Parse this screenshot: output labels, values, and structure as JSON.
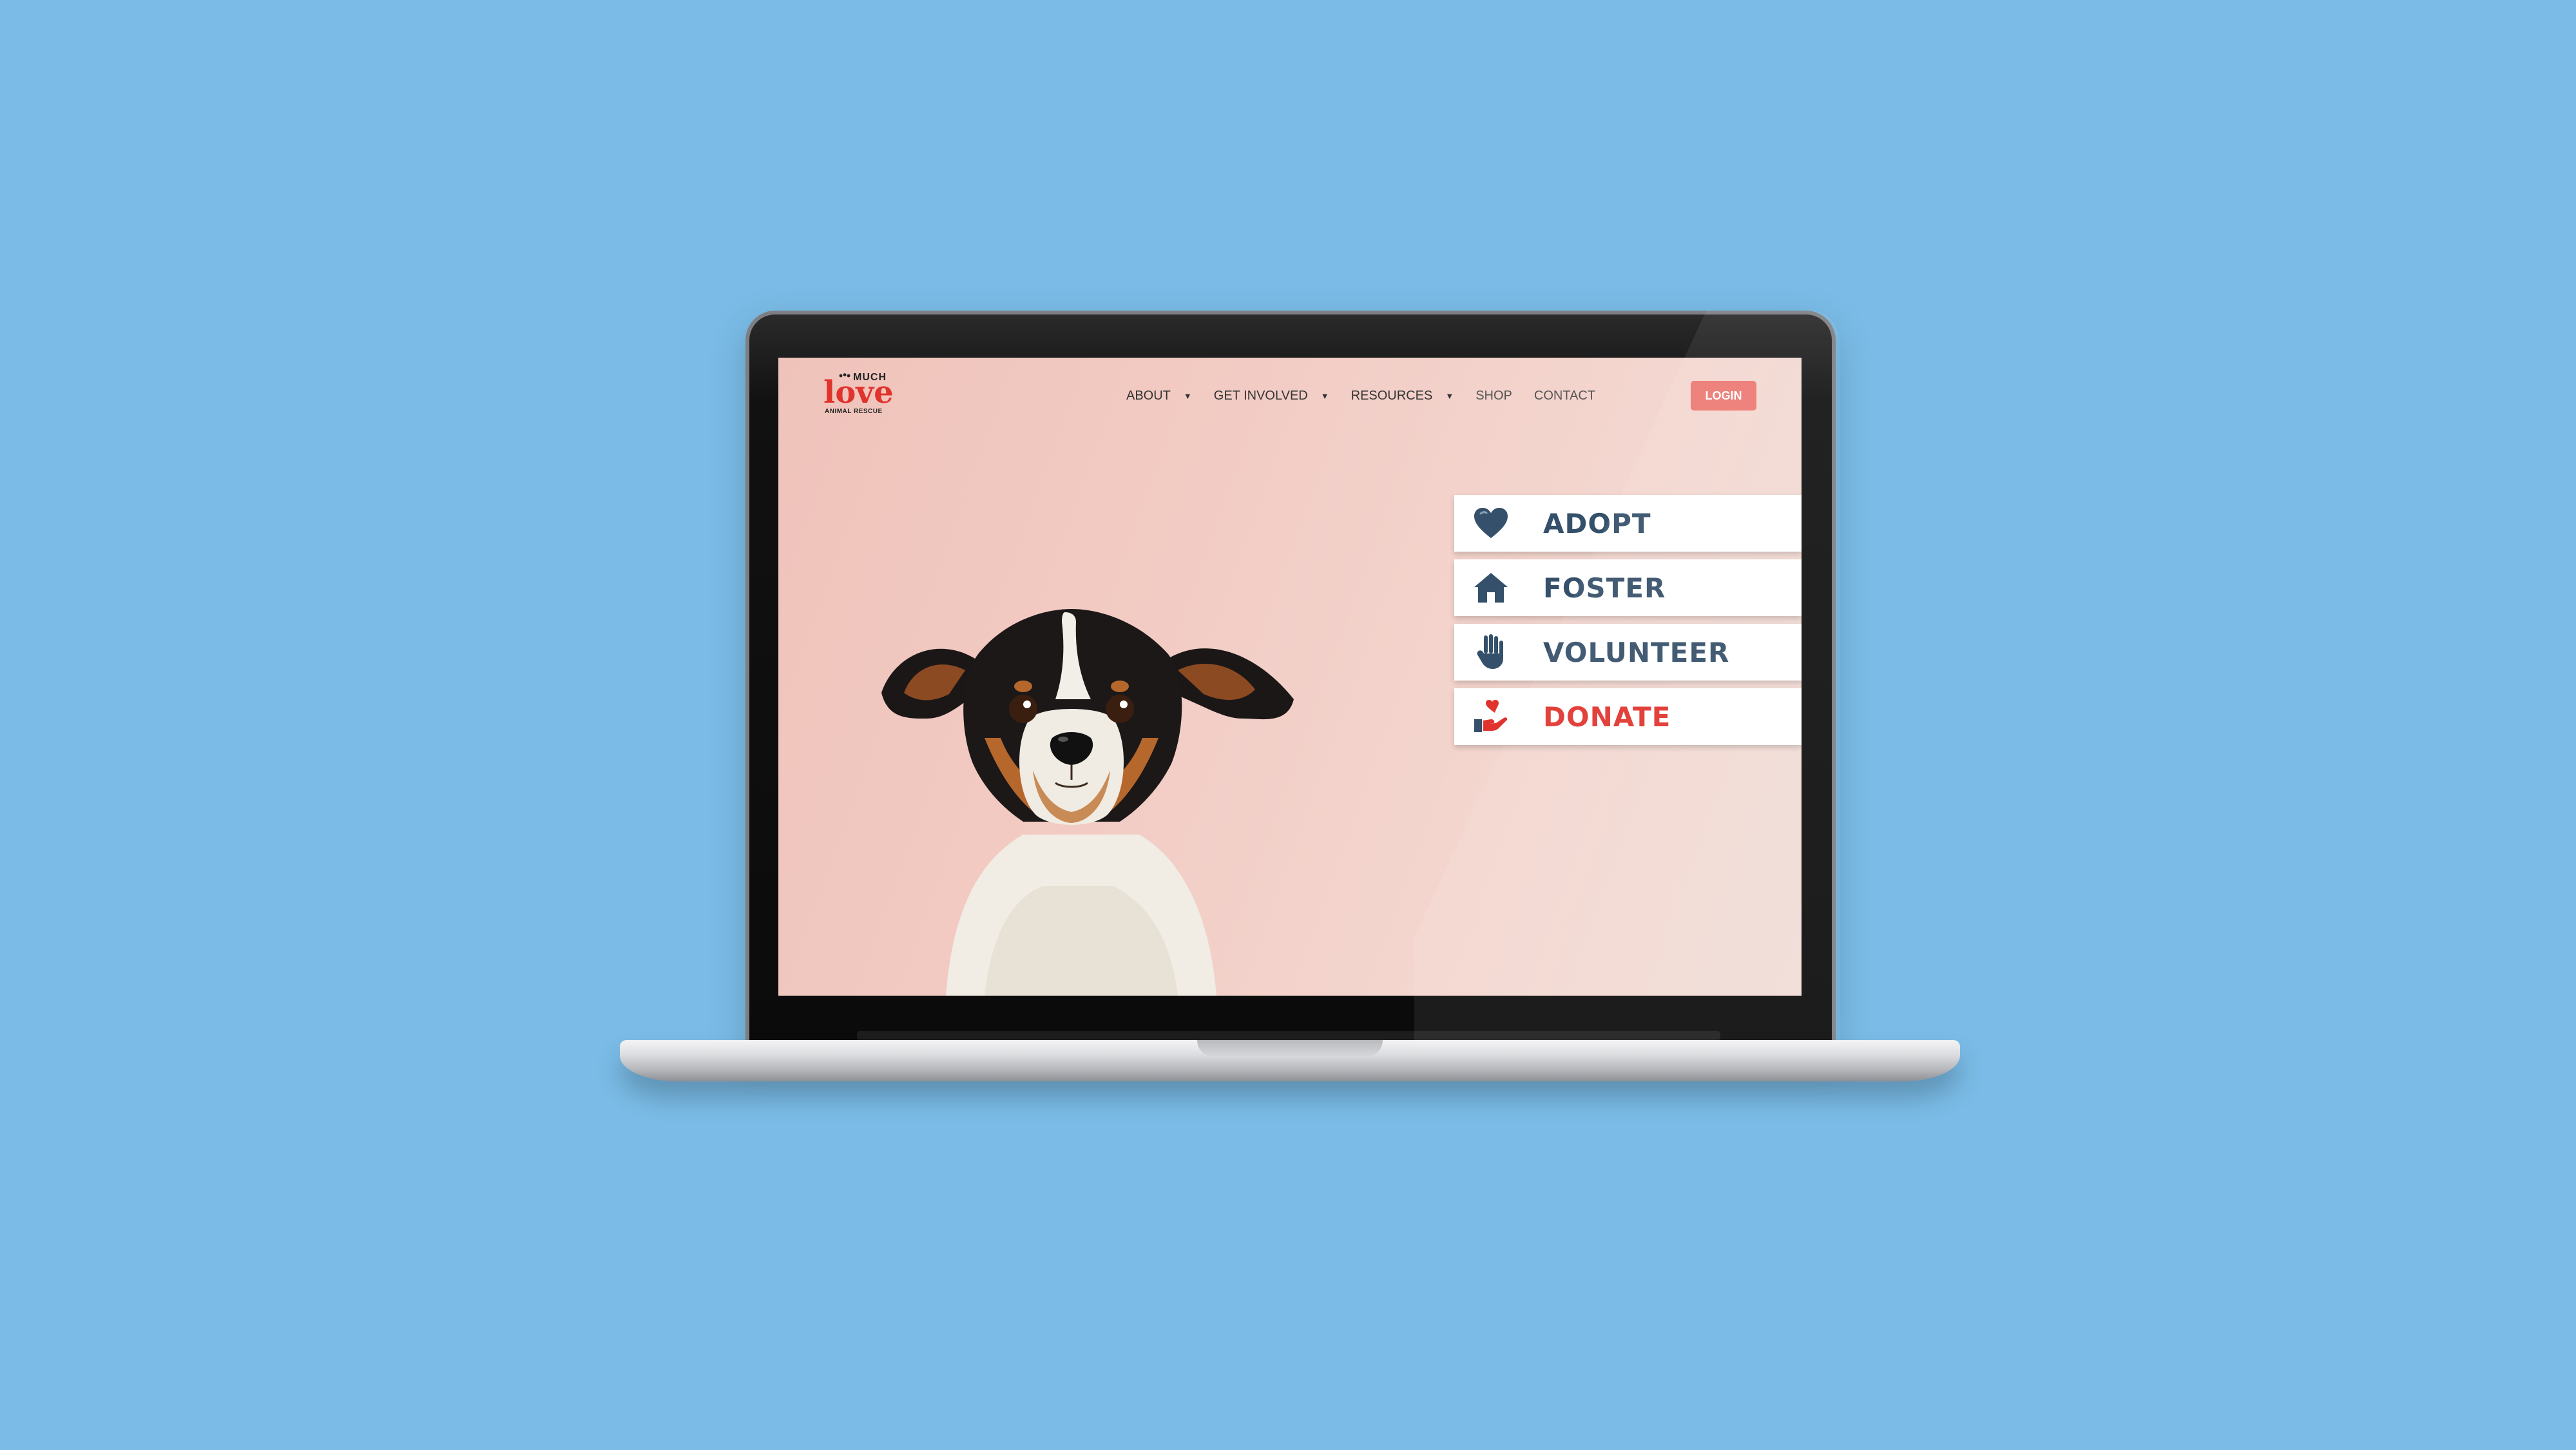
{
  "site": {
    "logo": {
      "top_word": "MUCH",
      "main_word": "love",
      "sub_text": "ANIMAL RESCUE",
      "icon": "paw-icon"
    },
    "nav": [
      {
        "label": "ABOUT",
        "has_dropdown": true
      },
      {
        "label": "GET INVOLVED",
        "has_dropdown": true
      },
      {
        "label": "RESOURCES",
        "has_dropdown": true
      },
      {
        "label": "SHOP",
        "has_dropdown": false
      },
      {
        "label": "CONTACT",
        "has_dropdown": false
      }
    ],
    "caret": "▼",
    "login_label": "LOGIN",
    "actions": [
      {
        "label": "ADOPT",
        "icon": "heart-icon"
      },
      {
        "label": "FOSTER",
        "icon": "home-icon"
      },
      {
        "label": "VOLUNTEER",
        "icon": "hand-icon"
      },
      {
        "label": "DONATE",
        "icon": "donate-hand-heart-icon"
      }
    ],
    "hero_image": "dog-photo",
    "colors": {
      "page_background": "#7abce7",
      "hero_background": "#f2cbc3",
      "accent_red": "#e0332d",
      "login_button": "#ec7a72",
      "action_text": "#35506a"
    }
  }
}
